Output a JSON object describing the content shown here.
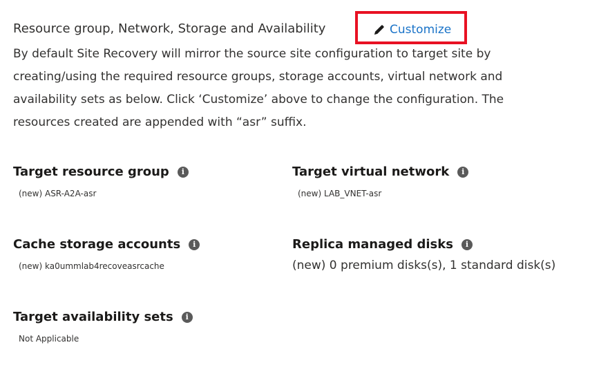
{
  "section": {
    "title": "Resource group, Network, Storage and Availability",
    "customize_label": "Customize",
    "description": "By default Site Recovery will mirror the source site configuration to target site by creating/using the required resource groups, storage accounts, virtual network and availability sets as below. Click ‘Customize’ above to change the configuration. The resources created are appended with “asr” suffix."
  },
  "fields": {
    "target_resource_group": {
      "label": "Target resource group",
      "value": "(new) ASR-A2A-asr"
    },
    "target_virtual_network": {
      "label": "Target virtual network",
      "value": "(new) LAB_VNET-asr"
    },
    "cache_storage_accounts": {
      "label": "Cache storage accounts",
      "value": "(new) ka0ummlab4recoveasrcache"
    },
    "replica_managed_disks": {
      "label": "Replica managed disks",
      "value": "(new) 0 premium disks(s), 1 standard disk(s)"
    },
    "target_availability_sets": {
      "label": "Target availability sets",
      "value": "Not Applicable"
    }
  },
  "icons": {
    "info": "info-icon",
    "edit": "pencil-icon"
  },
  "colors": {
    "link": "#1a73c8",
    "highlight_border": "#e81123",
    "text": "#323130"
  }
}
